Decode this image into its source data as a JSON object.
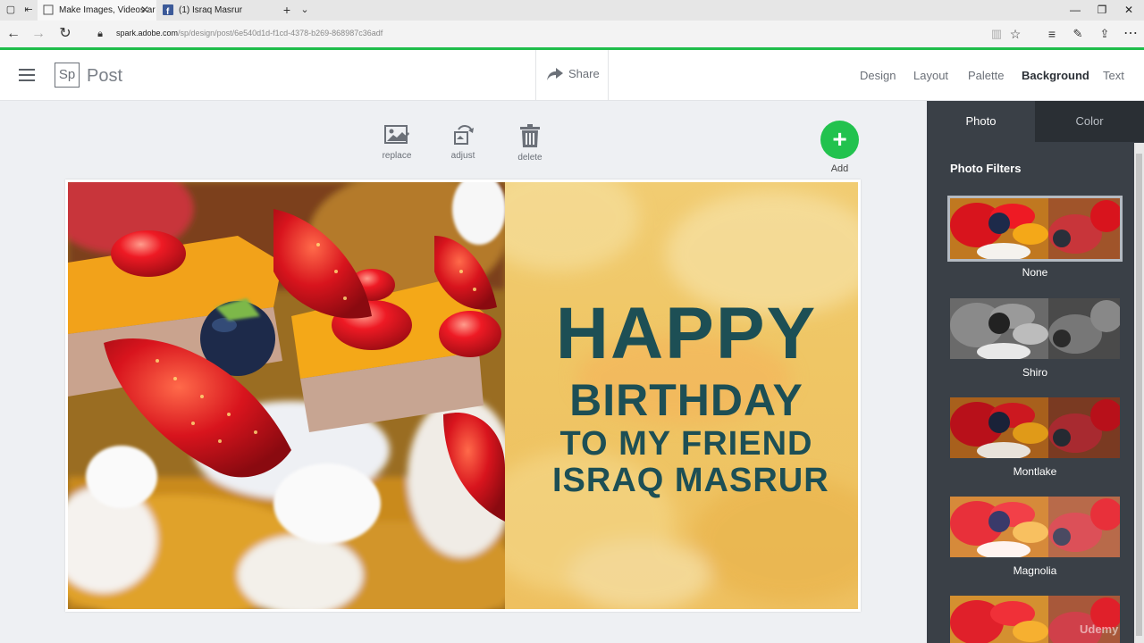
{
  "browser": {
    "tabs": [
      {
        "title": "Make Images, Videos ar",
        "active": true
      },
      {
        "title": "(1) Israq Masrur",
        "active": false
      }
    ],
    "url_domain": "spark.adobe.com",
    "url_path": "/sp/design/post/6e540d1d-f1cd-4378-b269-868987c36adf"
  },
  "header": {
    "logo": "Sp",
    "app_name": "Post",
    "share_label": "Share",
    "menu": [
      "Design",
      "Layout",
      "Palette",
      "Background",
      "Text"
    ],
    "active_menu": "Background"
  },
  "toolbar": {
    "replace_label": "replace",
    "adjust_label": "adjust",
    "delete_label": "delete",
    "add_label": "Add"
  },
  "card": {
    "line1": "HAPPY",
    "line2": "BIRTHDAY",
    "line3": "TO MY FRIEND",
    "line4": "ISRAQ MASRUR"
  },
  "panel": {
    "tabs": [
      "Photo",
      "Color"
    ],
    "section_title": "Photo Filters",
    "filters": [
      "None",
      "Shiro",
      "Montlake",
      "Magnolia"
    ],
    "selected_filter": "None"
  },
  "colors": {
    "accent": "#22c24e",
    "text_dark": "#1d4f55",
    "panel_bg": "#3a4047"
  },
  "watermark": "Udemy"
}
